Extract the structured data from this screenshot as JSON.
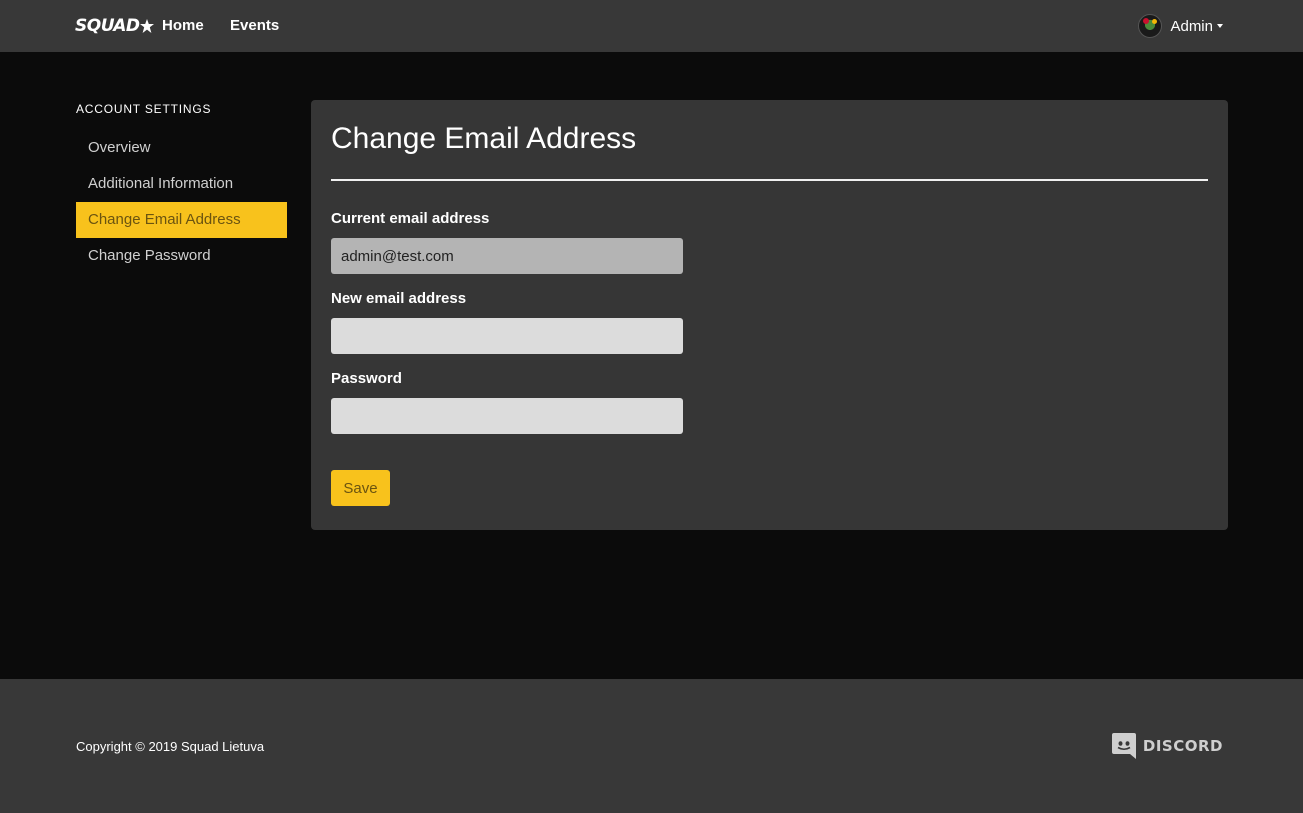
{
  "navbar": {
    "brand": "SQUAD",
    "links": [
      {
        "label": "Home"
      },
      {
        "label": "Events"
      }
    ],
    "user": {
      "name": "Admin"
    }
  },
  "sidebar": {
    "heading": "Account Settings",
    "items": [
      {
        "label": "Overview",
        "active": false
      },
      {
        "label": "Additional Information",
        "active": false
      },
      {
        "label": "Change Email Address",
        "active": true
      },
      {
        "label": "Change Password",
        "active": false
      }
    ]
  },
  "form": {
    "title": "Change Email Address",
    "current_email": {
      "label": "Current email address",
      "value": "admin@test.com"
    },
    "new_email": {
      "label": "New email address",
      "value": ""
    },
    "password": {
      "label": "Password",
      "value": ""
    },
    "save_label": "Save"
  },
  "footer": {
    "copyright": "Copyright © 2019 Squad Lietuva",
    "discord_label": "DISCORD"
  },
  "colors": {
    "accent": "#f8c21c",
    "navbar": "#383838",
    "background": "#0b0b0b",
    "card": "#363636"
  }
}
